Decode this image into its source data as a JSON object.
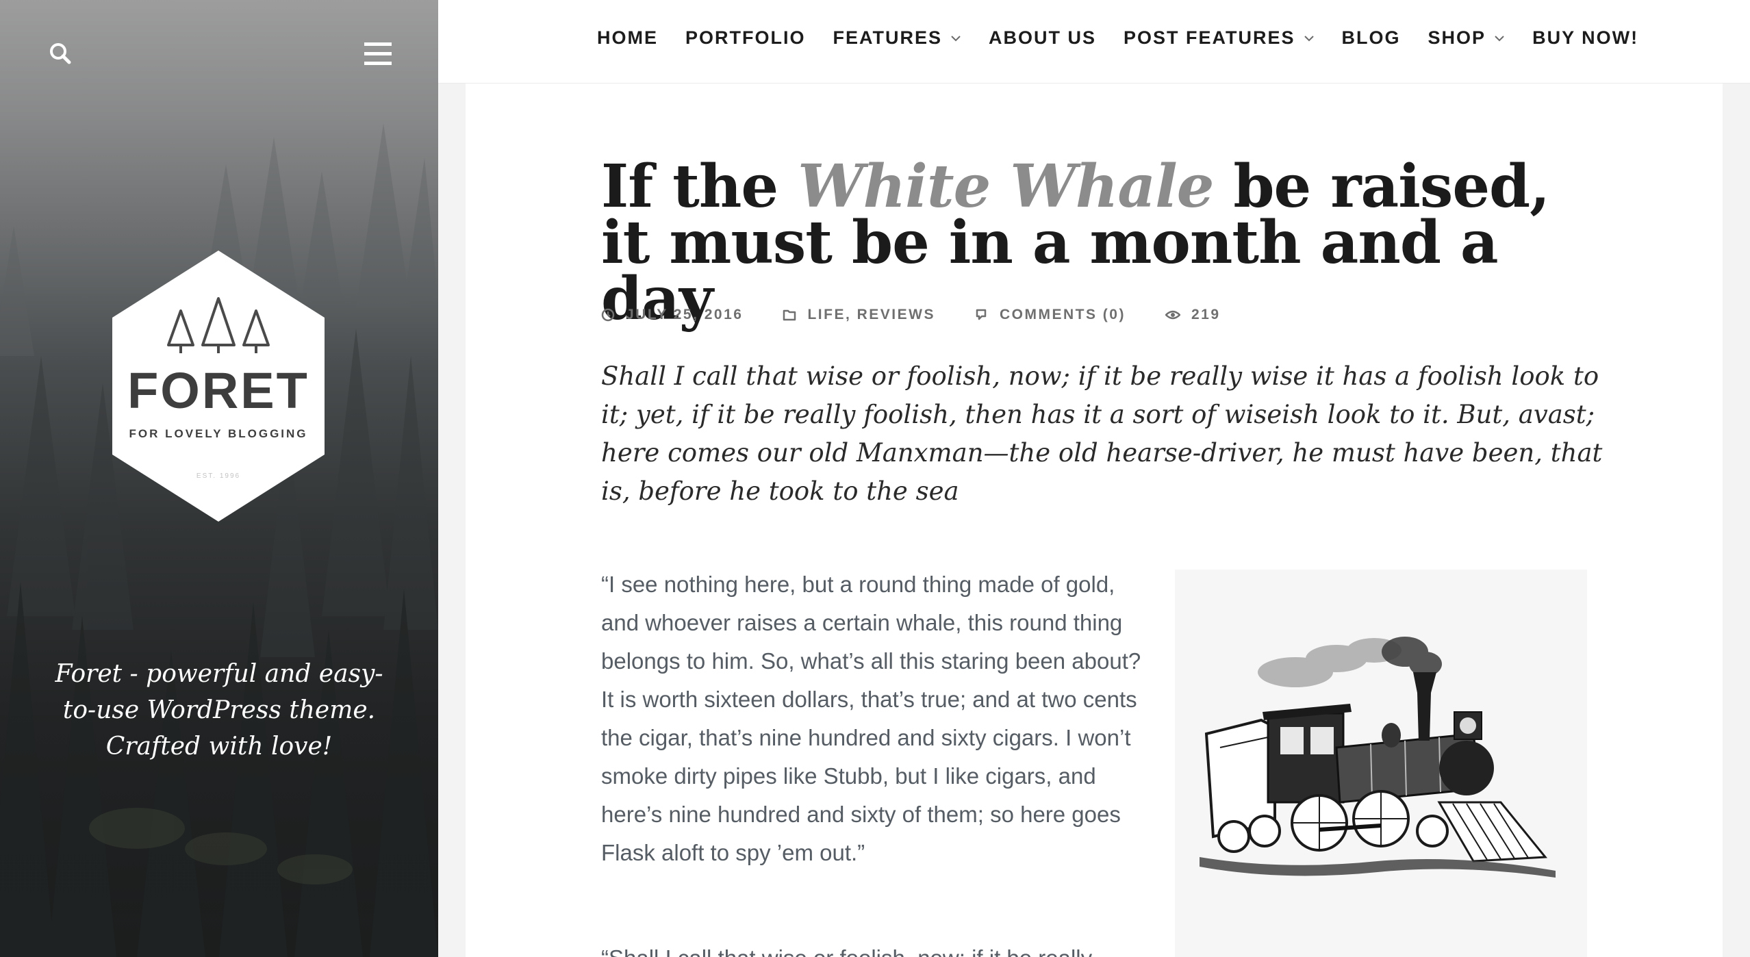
{
  "sidebar": {
    "search_icon": "search-icon",
    "menu_icon": "hamburger-menu-icon",
    "logo": {
      "name": "FORET",
      "tagline": "FOR LOVELY BLOGGING",
      "est": "EST. 1996",
      "icon": "trees-icon"
    },
    "description": "Foret - powerful and easy-to-use WordPress theme. Crafted with love!"
  },
  "nav": {
    "items": [
      {
        "label": "HOME",
        "dropdown": false
      },
      {
        "label": "PORTFOLIO",
        "dropdown": false
      },
      {
        "label": "FEATURES",
        "dropdown": true
      },
      {
        "label": "ABOUT US",
        "dropdown": false
      },
      {
        "label": "POST FEATURES",
        "dropdown": true
      },
      {
        "label": "BLOG",
        "dropdown": false
      },
      {
        "label": "SHOP",
        "dropdown": true
      },
      {
        "label": "BUY NOW!",
        "dropdown": false
      }
    ]
  },
  "post": {
    "title_before": "If the ",
    "title_highlight": "White Whale",
    "title_after": " be raised, it must be in a month and a day",
    "meta": {
      "date": "JULY 25, 2016",
      "date_icon": "clock-icon",
      "categories": "LIFE, REVIEWS",
      "categories_icon": "folder-icon",
      "comments": "COMMENTS (0)",
      "comments_icon": "comment-icon",
      "views": "219",
      "views_icon": "eye-icon"
    },
    "lead": "Shall I call that wise or foolish, now; if it be really wise it has a foolish look to it; yet, if it be really foolish, then has it a sort of wiseish look to it. But, avast; here comes our old Manxman—the old hearse-driver, he must have been, that is, before he took to the sea",
    "paragraph_1": "“I see nothing here, but a round thing made of gold, and whoever raises a certain whale, this round thing belongs to him. So, what’s all this staring been about? It is worth sixteen dollars, that’s true; and at two cents the cigar, that’s nine hundred and sixty cigars. I won’t smoke dirty pipes like Stubb, but I like cigars, and here’s nine hundred and sixty of them; so here goes Flask aloft to spy ’em out.”",
    "paragraph_2": "“Shall I call that wise or foolish, now; if it be really",
    "image": "steam-locomotive-engraving"
  }
}
